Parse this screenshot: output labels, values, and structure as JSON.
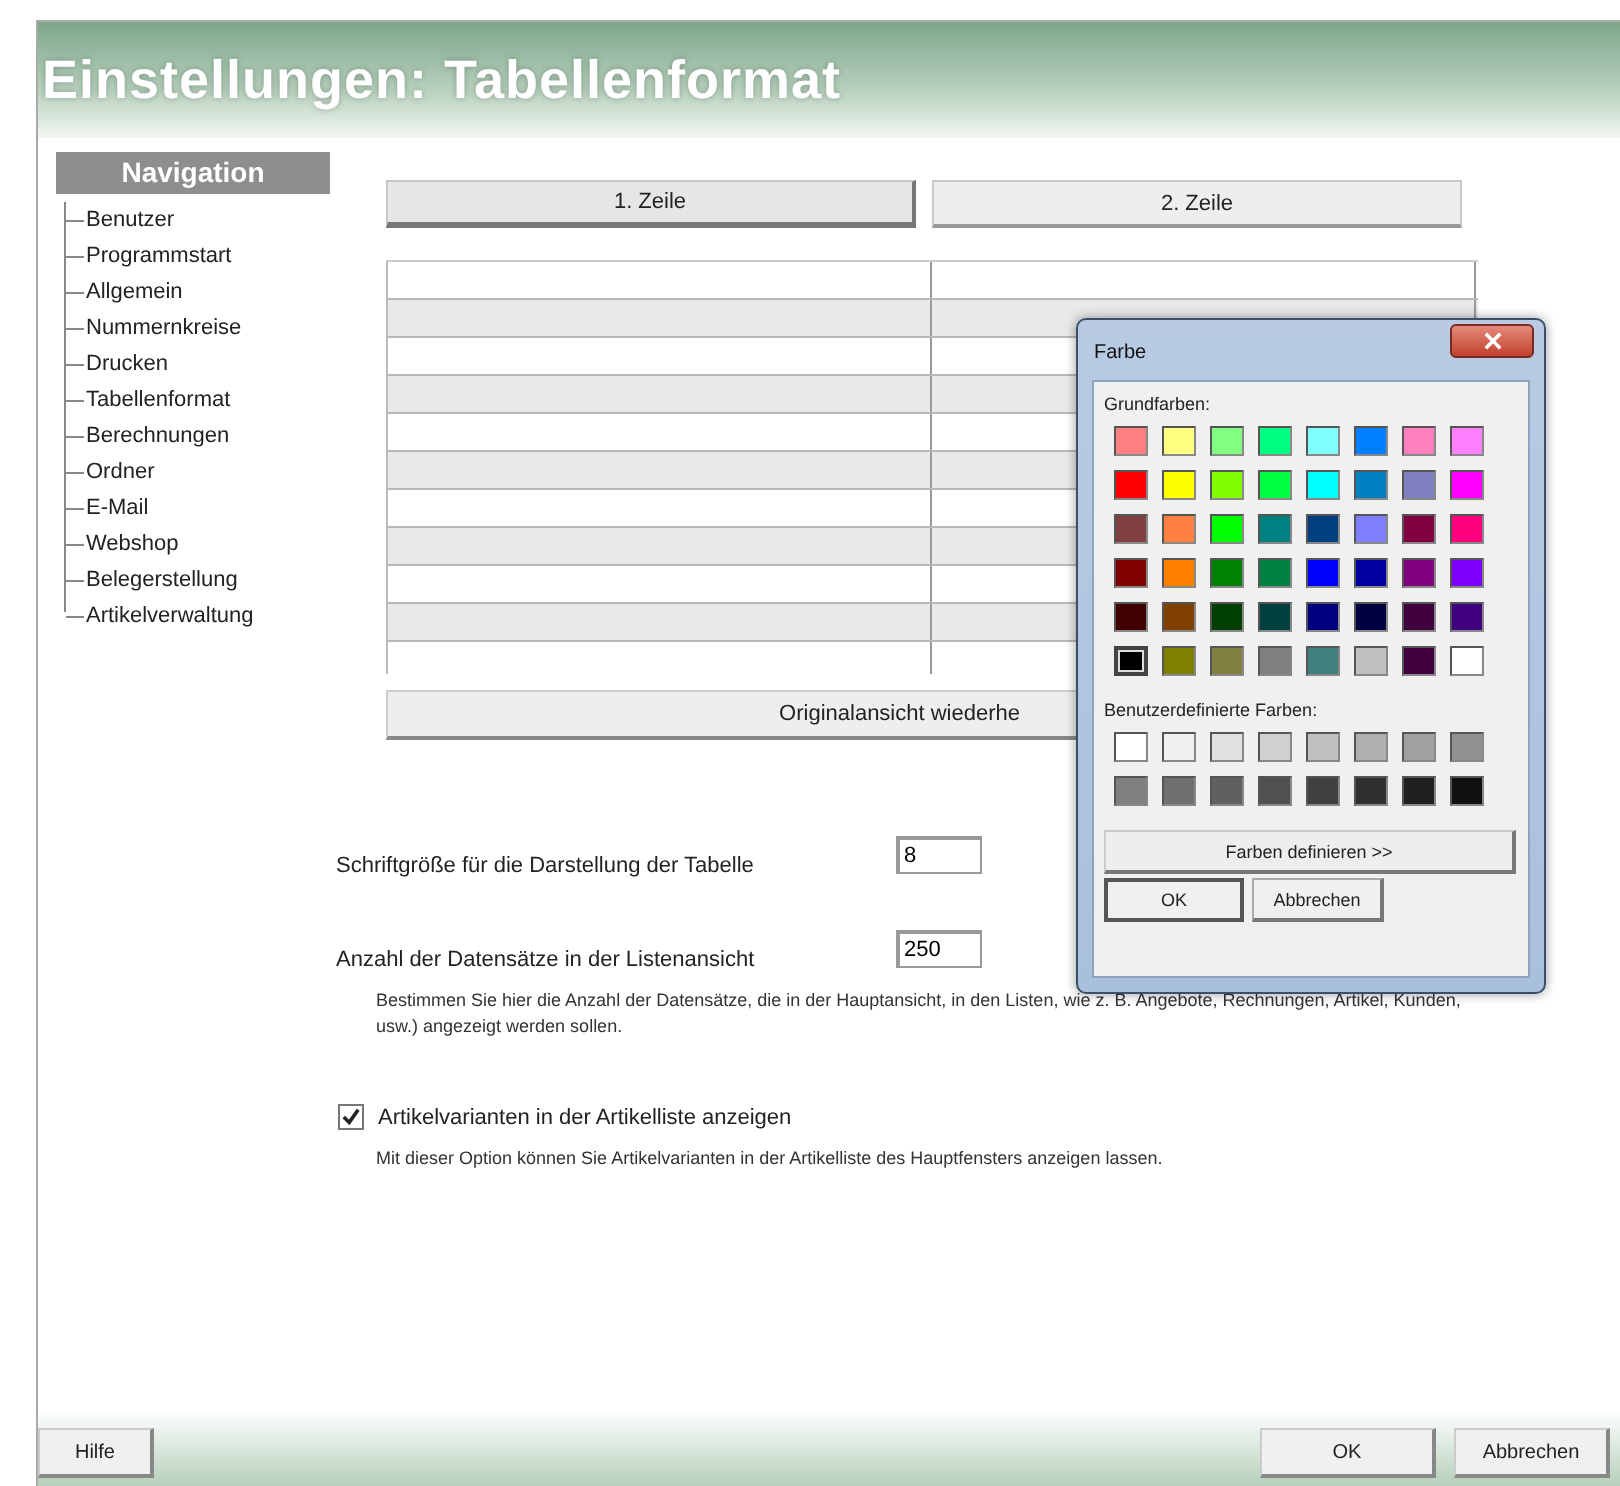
{
  "window": {
    "title": "Einstellungen: Tabellenformat"
  },
  "navigation": {
    "title": "Navigation",
    "items": [
      "Benutzer",
      "Programmstart",
      "Allgemein",
      "Nummernkreise",
      "Drucken",
      "Tabellenformat",
      "Berechnungen",
      "Ordner",
      "E-Mail",
      "Webshop",
      "Belegerstellung",
      "Artikelverwaltung"
    ]
  },
  "row_tabs": [
    {
      "label": "1. Zeile",
      "selected": true
    },
    {
      "label": "2. Zeile",
      "selected": false
    }
  ],
  "reset_button": "Originalansicht wiederhe",
  "font_size": {
    "label": "Schriftgröße für die Darstellung der Tabelle",
    "value": "8"
  },
  "record_count": {
    "label": "Anzahl der Datensätze in der Listenansicht",
    "value": "250",
    "description": "Bestimmen Sie hier die Anzahl der Datensätze, die in der Hauptansicht, in den Listen, wie z. B. Angebote, Rechnungen, Artikel, Kunden, usw.) angezeigt werden sollen."
  },
  "variants_option": {
    "label": "Artikelvarianten in der Artikelliste anzeigen",
    "checked": true,
    "description": "Mit dieser Option können Sie Artikelvarianten in der Artikelliste des Hauptfensters anzeigen lassen."
  },
  "color_dialog": {
    "title": "Farbe",
    "basic_colors_label": "Grundfarben:",
    "basic_colors": [
      {
        "color": "#ff8080",
        "selected": false
      },
      {
        "color": "#ffff80",
        "selected": false
      },
      {
        "color": "#80ff80",
        "selected": false
      },
      {
        "color": "#00ff80",
        "selected": false
      },
      {
        "color": "#80ffff",
        "selected": false
      },
      {
        "color": "#0080ff",
        "selected": false
      },
      {
        "color": "#ff80c0",
        "selected": false
      },
      {
        "color": "#ff80ff",
        "selected": false
      },
      {
        "color": "#ff0000",
        "selected": false
      },
      {
        "color": "#ffff00",
        "selected": false
      },
      {
        "color": "#80ff00",
        "selected": false
      },
      {
        "color": "#00ff40",
        "selected": false
      },
      {
        "color": "#00ffff",
        "selected": false
      },
      {
        "color": "#0080c0",
        "selected": false
      },
      {
        "color": "#8080c0",
        "selected": false
      },
      {
        "color": "#ff00ff",
        "selected": false
      },
      {
        "color": "#804040",
        "selected": false
      },
      {
        "color": "#ff8040",
        "selected": false
      },
      {
        "color": "#00ff00",
        "selected": false
      },
      {
        "color": "#008080",
        "selected": false
      },
      {
        "color": "#004080",
        "selected": false
      },
      {
        "color": "#8080ff",
        "selected": false
      },
      {
        "color": "#800040",
        "selected": false
      },
      {
        "color": "#ff0080",
        "selected": false
      },
      {
        "color": "#800000",
        "selected": false
      },
      {
        "color": "#ff8000",
        "selected": false
      },
      {
        "color": "#008000",
        "selected": false
      },
      {
        "color": "#008040",
        "selected": false
      },
      {
        "color": "#0000ff",
        "selected": false
      },
      {
        "color": "#0000a0",
        "selected": false
      },
      {
        "color": "#800080",
        "selected": false
      },
      {
        "color": "#8000ff",
        "selected": false
      },
      {
        "color": "#400000",
        "selected": false
      },
      {
        "color": "#804000",
        "selected": false
      },
      {
        "color": "#004000",
        "selected": false
      },
      {
        "color": "#004040",
        "selected": false
      },
      {
        "color": "#000080",
        "selected": false
      },
      {
        "color": "#000040",
        "selected": false
      },
      {
        "color": "#400040",
        "selected": false
      },
      {
        "color": "#400080",
        "selected": false
      },
      {
        "color": "#000000",
        "selected": true
      },
      {
        "color": "#808000",
        "selected": false
      },
      {
        "color": "#808040",
        "selected": false
      },
      {
        "color": "#808080",
        "selected": false
      },
      {
        "color": "#408080",
        "selected": false
      },
      {
        "color": "#c0c0c0",
        "selected": false
      },
      {
        "color": "#400040",
        "selected": false
      },
      {
        "color": "#ffffff",
        "selected": false
      }
    ],
    "custom_colors_label": "Benutzerdefinierte Farben:",
    "custom_colors": [
      {
        "color": "#ffffff"
      },
      {
        "color": "#f0f0f0"
      },
      {
        "color": "#e0e0e0"
      },
      {
        "color": "#d0d0d0"
      },
      {
        "color": "#c0c0c0"
      },
      {
        "color": "#b0b0b0"
      },
      {
        "color": "#a0a0a0"
      },
      {
        "color": "#909090"
      },
      {
        "color": "#808080"
      },
      {
        "color": "#707070"
      },
      {
        "color": "#606060"
      },
      {
        "color": "#505050"
      },
      {
        "color": "#404040"
      },
      {
        "color": "#303030"
      },
      {
        "color": "#202020"
      },
      {
        "color": "#101010"
      }
    ],
    "define_button": "Farben definieren >>",
    "buttons": [
      "OK",
      "Abbrechen"
    ]
  },
  "footer": {
    "help_button": "Hilfe",
    "buttons": [
      "OK",
      "Abbrechen"
    ]
  }
}
